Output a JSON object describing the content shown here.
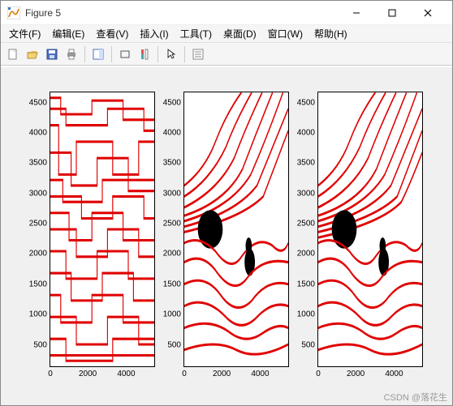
{
  "window": {
    "title": "Figure 5",
    "min_label": "Minimize",
    "max_label": "Maximize",
    "close_label": "Close"
  },
  "menu": {
    "file": "文件(F)",
    "edit": "编辑(E)",
    "view": "查看(V)",
    "insert": "插入(I)",
    "tools": "工具(T)",
    "desktop": "桌面(D)",
    "window": "窗口(W)",
    "help": "帮助(H)"
  },
  "toolbar": {
    "new": "new-figure",
    "open": "open",
    "save": "save",
    "print": "print",
    "edit_plot": "edit-plot",
    "datacursor": "data-cursor",
    "colorbar": "colorbar",
    "legend": "legend",
    "pointer": "pointer",
    "property": "property-inspector"
  },
  "chart_data": [
    {
      "type": "contour",
      "title": "",
      "xlabel": "",
      "ylabel": "",
      "xlim": [
        0,
        5500
      ],
      "ylim": [
        0,
        5000
      ],
      "xticks": [
        0,
        2000,
        4000
      ],
      "yticks": [
        500,
        1000,
        1500,
        2000,
        2500,
        3000,
        3500,
        4000,
        4500
      ],
      "color": "#e00000",
      "description": "contour plot with rectilinear/stepped level curves"
    },
    {
      "type": "contour",
      "title": "",
      "xlabel": "",
      "ylabel": "",
      "xlim": [
        0,
        5500
      ],
      "ylim": [
        0,
        5000
      ],
      "xticks": [
        0,
        2000,
        4000
      ],
      "yticks": [
        500,
        1000,
        1500,
        2000,
        2500,
        3000,
        3500,
        4000,
        4500
      ],
      "color": "#e00000",
      "description": "contour plot with smooth curved level curves"
    },
    {
      "type": "contour",
      "title": "",
      "xlabel": "",
      "ylabel": "",
      "xlim": [
        0,
        5500
      ],
      "ylim": [
        0,
        5000
      ],
      "xticks": [
        0,
        2000,
        4000
      ],
      "yticks": [
        500,
        1000,
        1500,
        2000,
        2500,
        3000,
        3500,
        4000,
        4500
      ],
      "color": "#e00000",
      "description": "contour plot with smooth curved level curves, similar to panel 2"
    }
  ],
  "watermark": "CSDN @落花生"
}
